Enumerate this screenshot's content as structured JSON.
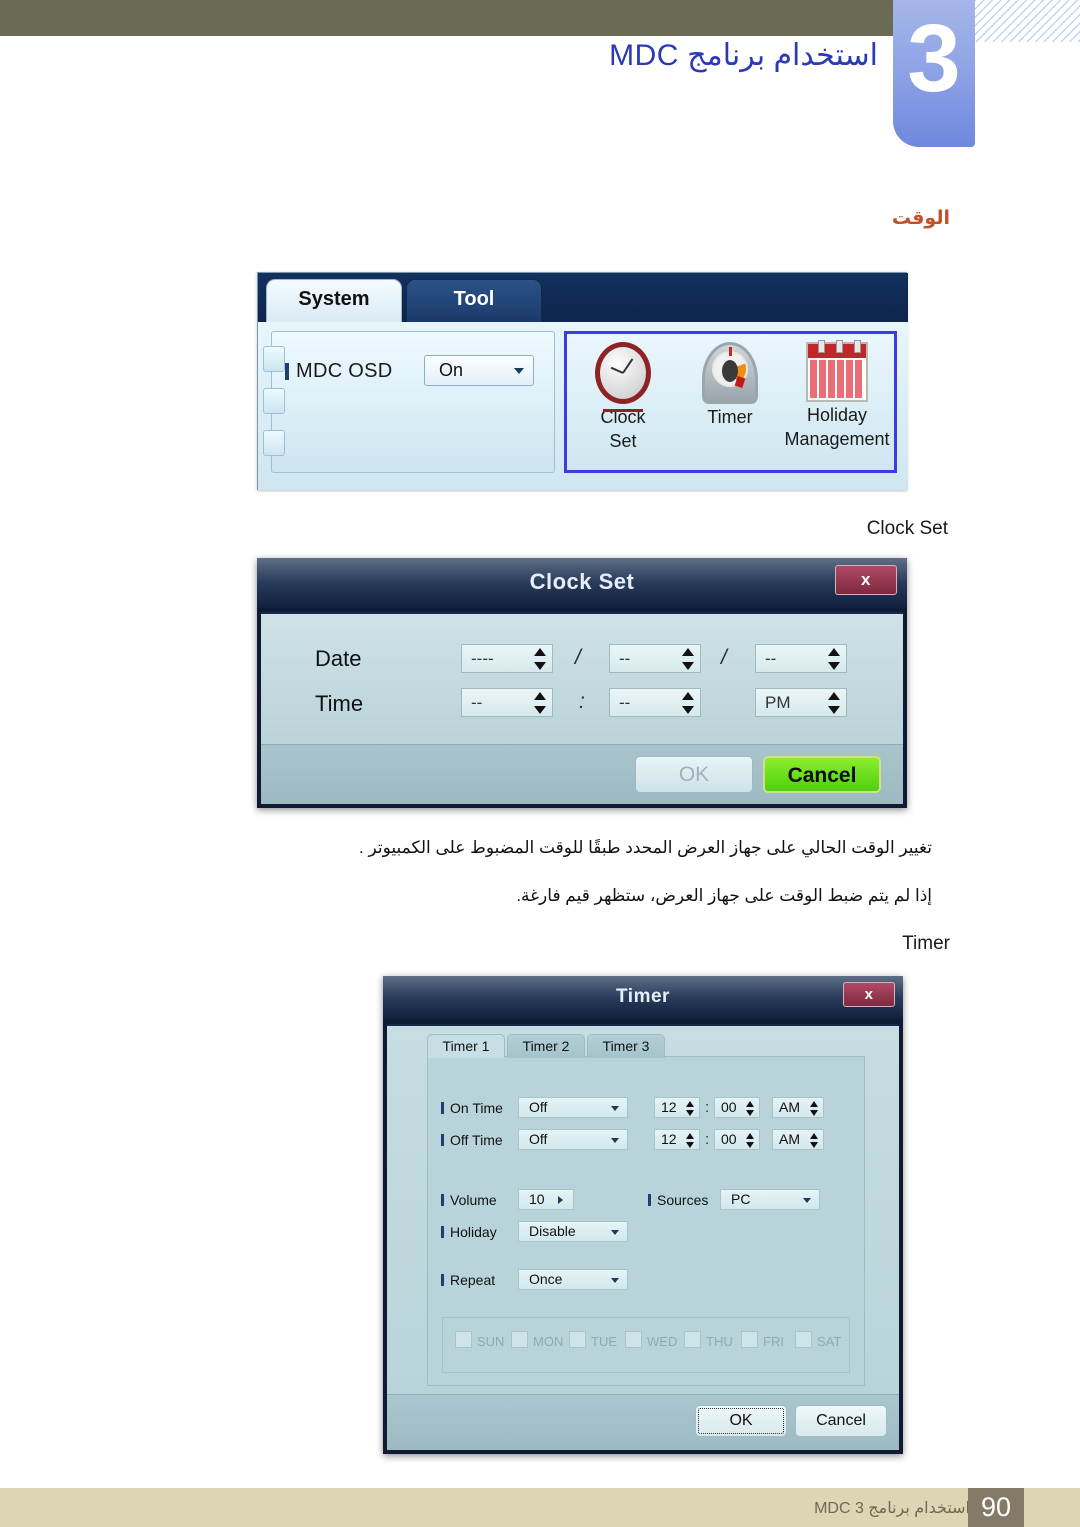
{
  "page": {
    "chapter_number": "3",
    "chapter_title": "استخدام برنامج MDC",
    "section_heading": "الوقت",
    "footer_page_number": "90",
    "footer_text": "استخدام برنامج MDC 3"
  },
  "tool_panel": {
    "tabs": [
      {
        "label": "System",
        "active": true
      },
      {
        "label": "Tool",
        "active": false
      }
    ],
    "osd": {
      "label": "MDC OSD",
      "value": "On",
      "arrow_icon": "chevron-down-icon"
    },
    "tiles": [
      {
        "label_line1": "Clock",
        "label_line2": "Set",
        "icon": "alarm-clock-icon"
      },
      {
        "label_line1": "Timer",
        "label_line2": "",
        "icon": "kitchen-timer-icon"
      },
      {
        "label_line1": "Holiday",
        "label_line2": "Management",
        "icon": "calendar-icon"
      }
    ]
  },
  "clock_set_caption": "Clock Set",
  "clock_set_dialog": {
    "title": "Clock Set",
    "close_label": "x",
    "date_label": "Date",
    "time_label": "Time",
    "date_year": "----",
    "date_month": "--",
    "date_day": "--",
    "date_sep_1": "/",
    "date_sep_2": "/",
    "time_hour": "--",
    "time_minute": "--",
    "time_meridiem": "PM",
    "time_sep": ":",
    "ok_label": "OK",
    "cancel_label": "Cancel"
  },
  "notes": {
    "line1": "تغيير الوقت الحالي على جهاز العرض المحدد طبقًا للوقت المضبوط على الكمبيوتر .",
    "line2": "إذا لم يتم ضبط الوقت على جهاز العرض، ستظهر قيم فارغة."
  },
  "timer_caption": "Timer",
  "timer_dialog": {
    "title": "Timer",
    "close_label": "x",
    "tabs": [
      {
        "label": "Timer 1",
        "active": true
      },
      {
        "label": "Timer 2",
        "active": false
      },
      {
        "label": "Timer 3",
        "active": false
      }
    ],
    "on_time": {
      "label": "On Time",
      "mode": "Off",
      "hour": "12",
      "minute": "00",
      "meridiem": "AM",
      "separator": ":"
    },
    "off_time": {
      "label": "Off Time",
      "mode": "Off",
      "hour": "12",
      "minute": "00",
      "meridiem": "AM",
      "separator": ":"
    },
    "volume": {
      "label": "Volume",
      "value": "10"
    },
    "sources": {
      "label": "Sources",
      "value": "PC"
    },
    "holiday": {
      "label": "Holiday",
      "value": "Disable"
    },
    "repeat": {
      "label": "Repeat",
      "value": "Once"
    },
    "days": [
      {
        "label": "SUN",
        "checked": false
      },
      {
        "label": "MON",
        "checked": false
      },
      {
        "label": "TUE",
        "checked": false
      },
      {
        "label": "WED",
        "checked": false
      },
      {
        "label": "THU",
        "checked": false
      },
      {
        "label": "FRI",
        "checked": false
      },
      {
        "label": "SAT",
        "checked": false
      }
    ],
    "ok_label": "OK",
    "cancel_label": "Cancel"
  },
  "colors": {
    "olive_bar": "#6b6a55",
    "chapter_badge": "#7e95e2",
    "chapter_title": "#2b39b5",
    "section_heading": "#c0522a",
    "dialog_body": "#b6d3da",
    "cancel_green": "#5fd615",
    "close_red": "#8e3050",
    "footer_bar": "#ddd5b4",
    "footer_number_bg": "#857a68",
    "highlight_border": "#3b3ddd"
  }
}
